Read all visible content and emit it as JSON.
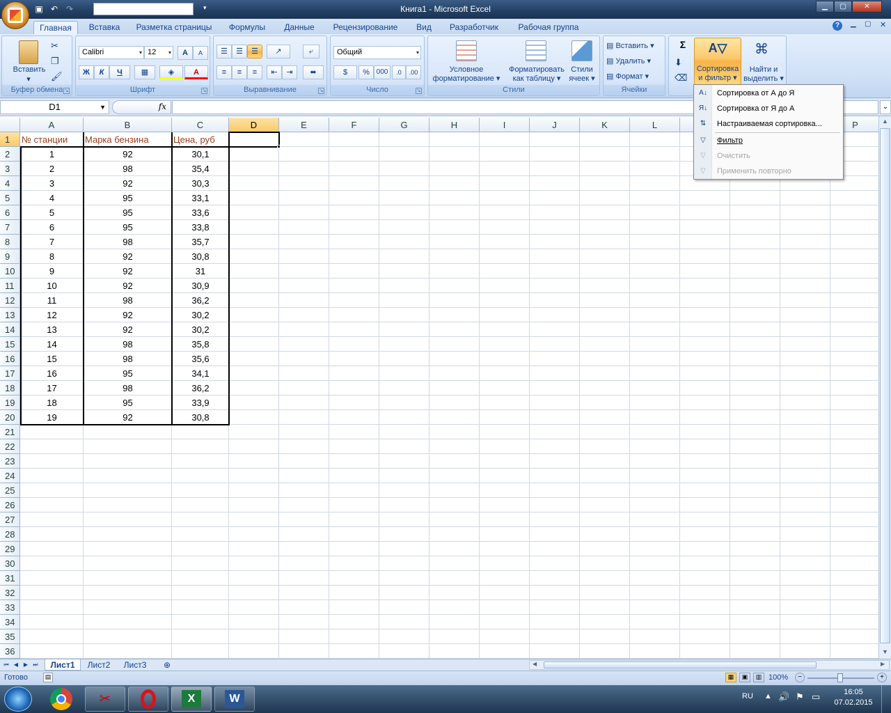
{
  "window": {
    "title": "Книга1 - Microsoft Excel"
  },
  "qat": {
    "icons": [
      "save-icon",
      "undo-icon",
      "redo-icon"
    ]
  },
  "tabs": [
    "Главная",
    "Вставка",
    "Разметка страницы",
    "Формулы",
    "Данные",
    "Рецензирование",
    "Вид",
    "Разработчик",
    "Рабочая группа"
  ],
  "ribbon": {
    "clipboard": {
      "paste": "Вставить",
      "label": "Буфер обмена"
    },
    "font": {
      "name": "Calibri",
      "size": "12",
      "bold": "Ж",
      "italic": "К",
      "underline": "Ч",
      "grow": "A",
      "shrink": "A",
      "color": "A",
      "label": "Шрифт"
    },
    "alignment": {
      "label": "Выравнивание"
    },
    "number": {
      "format": "Общий",
      "percent": "%",
      "thousands": "000",
      "label": "Число"
    },
    "styles": {
      "conditional": [
        "Условное",
        "форматирование ▾"
      ],
      "as_table": [
        "Форматировать",
        "как таблицу ▾"
      ],
      "cell_styles": [
        "Стили",
        "ячеек ▾"
      ],
      "label": "Стили"
    },
    "cells": {
      "insert": "Вставить",
      "delete": "Удалить",
      "format": "Формат",
      "label": "Ячейки"
    },
    "editing": {
      "sigma": "Σ",
      "sort": [
        "Сортировка",
        "и фильтр ▾"
      ],
      "find": [
        "Найти и",
        "выделить ▾"
      ]
    }
  },
  "formula_bar": {
    "name_box": "D1",
    "fx": "fx",
    "value": ""
  },
  "columns": [
    "A",
    "B",
    "C",
    "D",
    "E",
    "F",
    "G",
    "H",
    "I",
    "J",
    "K",
    "L",
    "M",
    "N",
    "O",
    "P"
  ],
  "rows": [
    "1",
    "2",
    "3",
    "4",
    "5",
    "6",
    "7",
    "8",
    "9",
    "10",
    "11",
    "12",
    "13",
    "14",
    "15",
    "16",
    "17",
    "18",
    "19",
    "20",
    "21",
    "22",
    "23",
    "24",
    "25",
    "26",
    "27",
    "28",
    "29",
    "30",
    "31",
    "32",
    "33",
    "34",
    "35",
    "36"
  ],
  "table": {
    "headers": [
      "№ станции",
      "Марка бензина",
      "Цена, руб"
    ],
    "data": [
      [
        "1",
        "92",
        "30,1"
      ],
      [
        "2",
        "98",
        "35,4"
      ],
      [
        "3",
        "92",
        "30,3"
      ],
      [
        "4",
        "95",
        "33,1"
      ],
      [
        "5",
        "95",
        "33,6"
      ],
      [
        "6",
        "95",
        "33,8"
      ],
      [
        "7",
        "98",
        "35,7"
      ],
      [
        "8",
        "92",
        "30,8"
      ],
      [
        "9",
        "92",
        "31"
      ],
      [
        "10",
        "92",
        "30,9"
      ],
      [
        "11",
        "98",
        "36,2"
      ],
      [
        "12",
        "92",
        "30,2"
      ],
      [
        "13",
        "92",
        "30,2"
      ],
      [
        "14",
        "98",
        "35,8"
      ],
      [
        "15",
        "98",
        "35,6"
      ],
      [
        "16",
        "95",
        "34,1"
      ],
      [
        "17",
        "98",
        "36,2"
      ],
      [
        "18",
        "95",
        "33,9"
      ],
      [
        "19",
        "92",
        "30,8"
      ]
    ]
  },
  "sort_menu": {
    "items": [
      "Сортировка от А до Я",
      "Сортировка от Я до А",
      "Настраиваемая сортировка...",
      "Фильтр",
      "Очистить",
      "Применить повторно"
    ]
  },
  "sheets": [
    "Лист1",
    "Лист2",
    "Лист3"
  ],
  "status": {
    "ready": "Готово",
    "zoom": "100%"
  },
  "taskbar": {
    "lang": "RU",
    "time": "16:05",
    "date": "07.02.2015"
  },
  "colors": {
    "header_text": "#9c3d1a",
    "ribbon_text": "#15428b",
    "highlight": "#f9b245"
  }
}
